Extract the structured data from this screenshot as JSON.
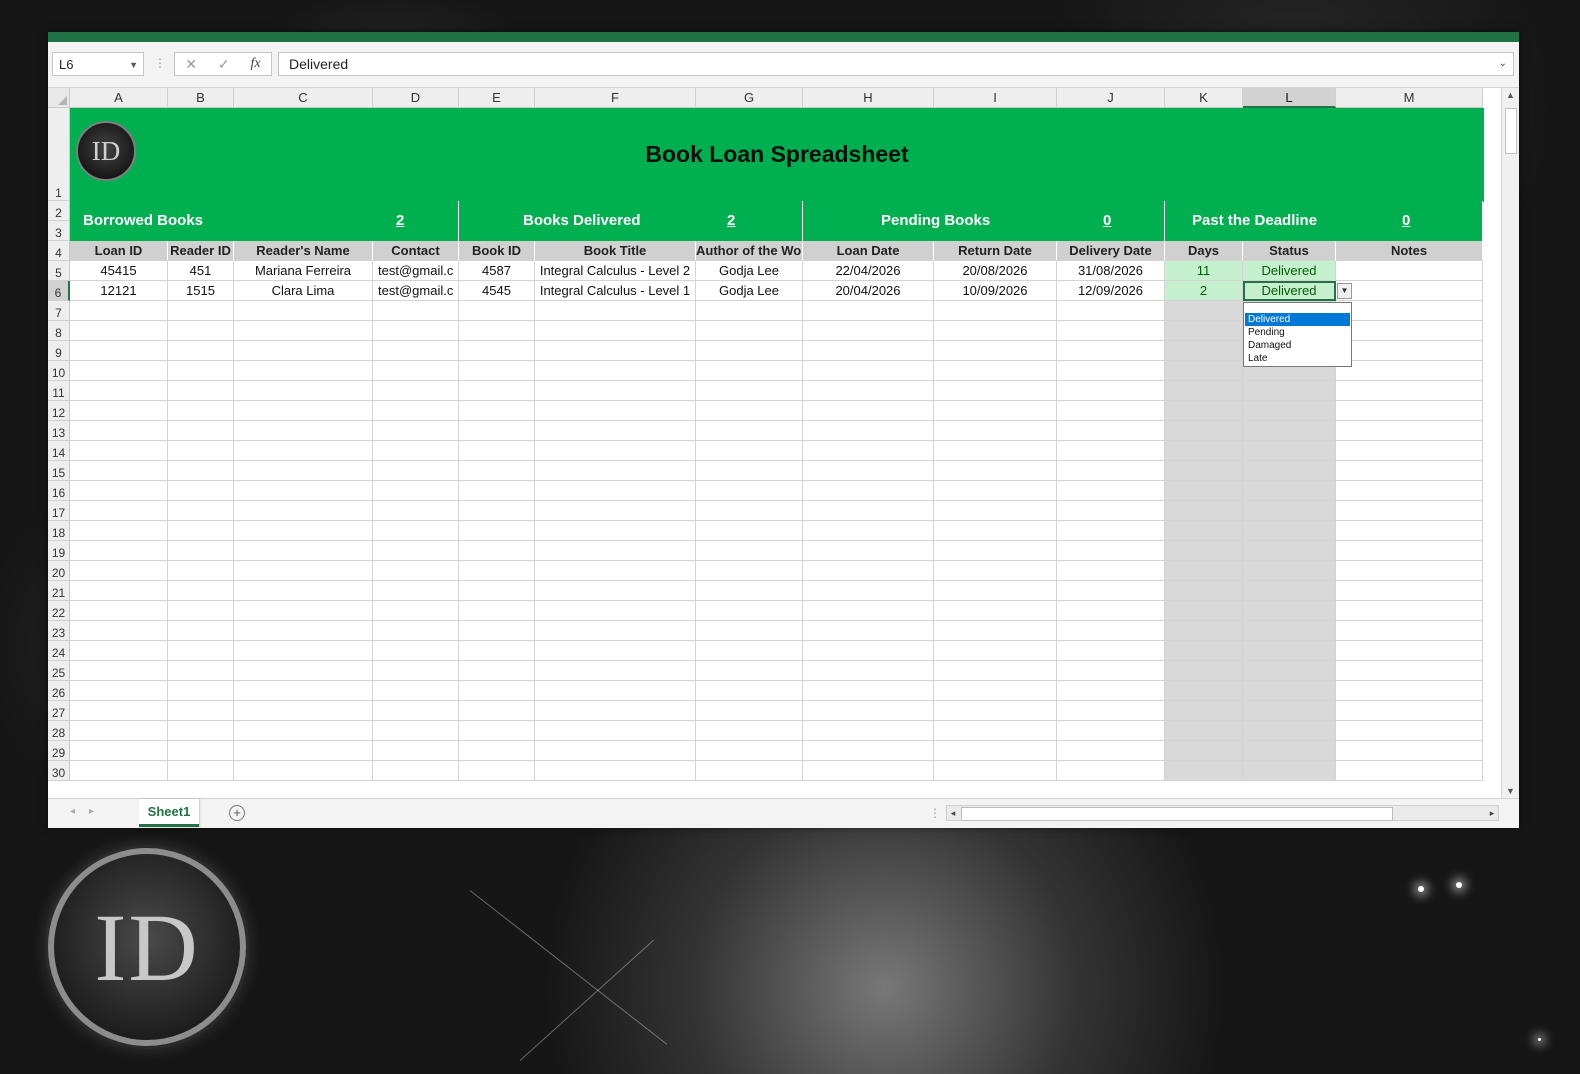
{
  "formula_bar": {
    "cell_ref": "L6",
    "cancel_icon": "✕",
    "enter_icon": "✓",
    "fx_label": "fx",
    "value": "Delivered"
  },
  "columns": [
    "A",
    "B",
    "C",
    "D",
    "E",
    "F",
    "G",
    "H",
    "I",
    "J",
    "K",
    "L",
    "M"
  ],
  "row_numbers": [
    "1",
    "2",
    "3",
    "4",
    "5",
    "6",
    "7",
    "8",
    "9",
    "10",
    "11",
    "12",
    "13",
    "14",
    "15",
    "16",
    "17",
    "18",
    "19",
    "20",
    "21",
    "22",
    "23",
    "24",
    "25",
    "26",
    "27",
    "28",
    "29",
    "30"
  ],
  "sheet": {
    "title": "Book Loan Spreadsheet",
    "logo_text": "ID",
    "summary": [
      {
        "label": "Borrowed Books",
        "value": "2"
      },
      {
        "label": "Books Delivered",
        "value": "2"
      },
      {
        "label": "Pending Books",
        "value": "0"
      },
      {
        "label": "Past the Deadline",
        "value": "0"
      }
    ],
    "headers": [
      "Loan ID",
      "Reader ID",
      "Reader's Name",
      "Contact",
      "Book ID",
      "Book Title",
      "Author of the Work",
      "Loan Date",
      "Return Date",
      "Delivery Date",
      "Days",
      "Status",
      "Notes"
    ],
    "rows": [
      [
        "45415",
        "451",
        "Mariana Ferreira",
        "test@gmail.c",
        "4587",
        "Integral Calculus - Level 2",
        "Godja Lee",
        "22/04/2026",
        "20/08/2026",
        "31/08/2026",
        "11",
        "Delivered",
        ""
      ],
      [
        "12121",
        "1515",
        "Clara Lima",
        "test@gmail.c",
        "4545",
        "Integral Calculus - Level 1",
        "Godja Lee",
        "20/04/2026",
        "10/09/2026",
        "12/09/2026",
        "2",
        "Delivered",
        ""
      ]
    ]
  },
  "status_dropdown": {
    "options": [
      "Delivered",
      "Pending",
      "Damaged",
      "Late"
    ],
    "selected": "Delivered"
  },
  "tabs": {
    "active": "Sheet1",
    "add_icon": "+"
  },
  "background_badge": "ID",
  "colors": {
    "excel_green": "#217346",
    "banner_green": "#00b050",
    "status_fill": "#c6efce",
    "status_text": "#006100"
  }
}
